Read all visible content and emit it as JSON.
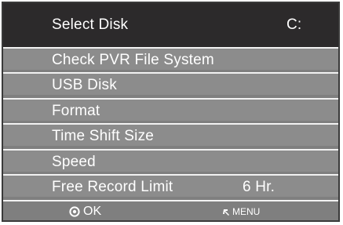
{
  "menu": {
    "items": [
      {
        "label": "Select Disk",
        "value": "C:",
        "selected": true
      },
      {
        "label": "Check PVR File System",
        "value": ""
      },
      {
        "label": "USB Disk",
        "value": ""
      },
      {
        "label": "Format",
        "value": ""
      },
      {
        "label": "Time Shift Size",
        "value": ""
      },
      {
        "label": "Speed",
        "value": ""
      },
      {
        "label": "Free Record Limit",
        "value": "6 Hr."
      }
    ]
  },
  "footer": {
    "ok_label": "OK",
    "menu_label": "MENU",
    "ok_icon": "ok-circle-icon",
    "menu_icon": "menu-return-icon"
  },
  "colors": {
    "selected_bg": "#2c2a2b",
    "item_bg": "#8c8c8c",
    "text": "#ffffff",
    "divider": "#f2f2f2"
  }
}
